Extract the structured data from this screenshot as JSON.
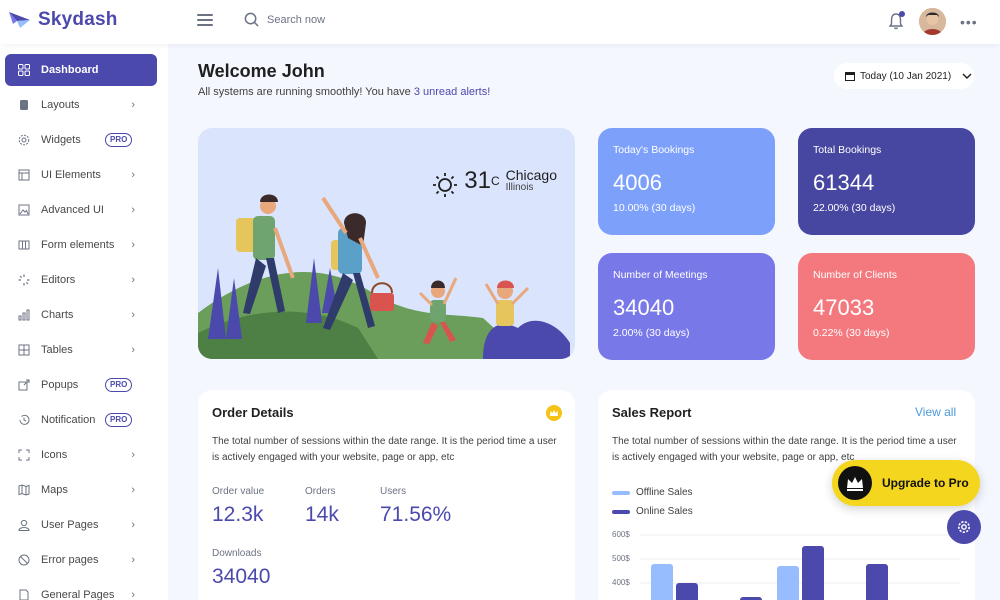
{
  "brand": {
    "name": "Skydash"
  },
  "header": {
    "search_placeholder": "Search now"
  },
  "sidebar": {
    "items": [
      {
        "label": "Dashboard",
        "icon": "grid-icon",
        "active": true
      },
      {
        "label": "Layouts",
        "icon": "layout-icon"
      },
      {
        "label": "Widgets",
        "icon": "gear-icon",
        "badge": "PRO"
      },
      {
        "label": "UI Elements",
        "icon": "layers-icon"
      },
      {
        "label": "Advanced UI",
        "icon": "image-icon"
      },
      {
        "label": "Form elements",
        "icon": "columns-icon"
      },
      {
        "label": "Editors",
        "icon": "loader-icon"
      },
      {
        "label": "Charts",
        "icon": "bar-chart-icon"
      },
      {
        "label": "Tables",
        "icon": "table-icon"
      },
      {
        "label": "Popups",
        "icon": "external-link-icon",
        "badge": "PRO"
      },
      {
        "label": "Notification",
        "icon": "history-icon",
        "badge": "PRO"
      },
      {
        "label": "Icons",
        "icon": "move-icon"
      },
      {
        "label": "Maps",
        "icon": "map-icon"
      },
      {
        "label": "User Pages",
        "icon": "user-icon"
      },
      {
        "label": "Error pages",
        "icon": "ban-icon"
      },
      {
        "label": "General Pages",
        "icon": "file-icon"
      }
    ]
  },
  "welcome": {
    "title": "Welcome John",
    "subtitle_prefix": "All systems are running smoothly! You have ",
    "subtitle_link": "3 unread alerts!"
  },
  "date_button": {
    "label": "Today (10 Jan 2021)"
  },
  "weather": {
    "temp": "31",
    "unit": "C",
    "city": "Chicago",
    "state": "Illinois"
  },
  "stats": [
    {
      "label": "Today's Bookings",
      "value": "4006",
      "sub": "10.00% (30 days)",
      "color": "#7da0fa"
    },
    {
      "label": "Total Bookings",
      "value": "61344",
      "sub": "22.00% (30 days)",
      "color": "#4747a1"
    },
    {
      "label": "Number of Meetings",
      "value": "34040",
      "sub": "2.00% (30 days)",
      "color": "#7978e9"
    },
    {
      "label": "Number of Clients",
      "value": "47033",
      "sub": "0.22% (30 days)",
      "color": "#f3797e"
    }
  ],
  "order_details": {
    "title": "Order Details",
    "text": "The total number of sessions within the date range. It is the period time a user is actively engaged with your website, page or app, etc",
    "metrics": [
      {
        "label": "Order value",
        "value": "12.3k"
      },
      {
        "label": "Orders",
        "value": "14k"
      },
      {
        "label": "Users",
        "value": "71.56%"
      },
      {
        "label": "Downloads",
        "value": "34040"
      }
    ]
  },
  "sales_report": {
    "title": "Sales Report",
    "view_all": "View all",
    "text": "The total number of sessions within the date range. It is the period time a user is actively engaged with your website, page or app, etc",
    "legend": [
      {
        "label": "Offline Sales",
        "color": "#98bdff"
      },
      {
        "label": "Online Sales",
        "color": "#4b49ac"
      }
    ],
    "y_ticks": [
      "600$",
      "500$",
      "400$"
    ]
  },
  "upgrade": {
    "label": "Upgrade to Pro"
  }
}
